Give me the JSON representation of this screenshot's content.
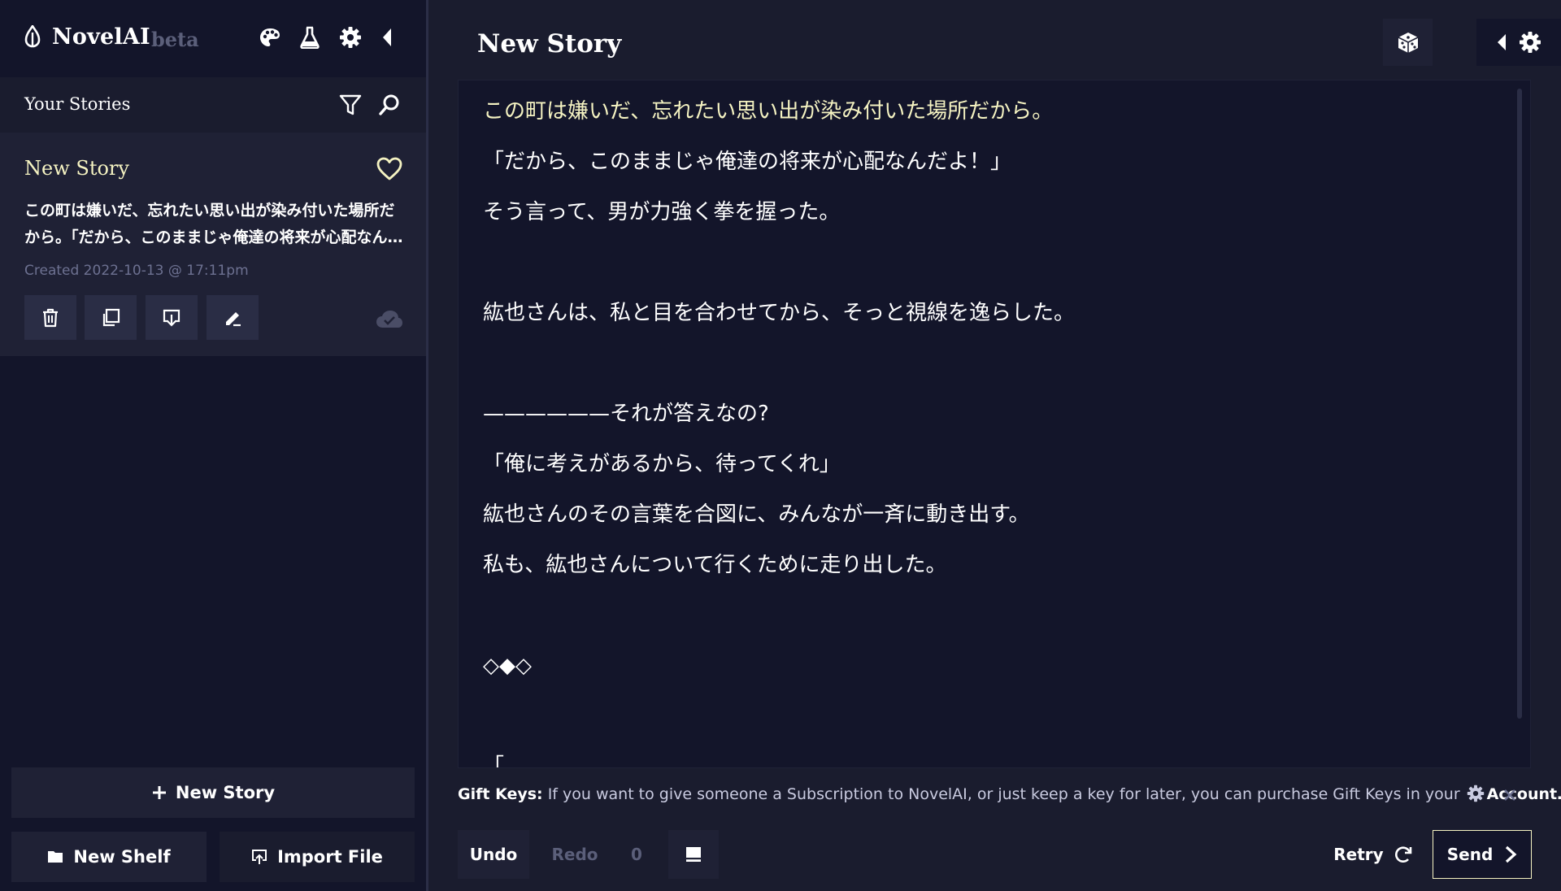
{
  "sidebar": {
    "brand": {
      "name": "NovelAI",
      "tag": "beta"
    },
    "header_icons": [
      "quill-logo-icon",
      "palette-icon",
      "flask-icon",
      "gear-icon",
      "collapse-left-icon"
    ],
    "stories_title": "Your Stories",
    "story_card": {
      "title": "New Story",
      "excerpt": "この町は嫌いだ、忘れたい思い出が染み付いた場所だから。「だから、このままじゃ俺達の将来が心配なんだよ！」",
      "created": "Created 2022-10-13 @ 17:11pm",
      "actions": [
        "trash-icon",
        "duplicate-icon",
        "download-icon",
        "edit-icon"
      ],
      "sync_icon": "cloud-icon"
    },
    "new_story_label": "New Story",
    "new_shelf_label": "New Shelf",
    "import_file_label": "Import File"
  },
  "main": {
    "title": "New Story",
    "editor_lines": [
      "この町は嫌いだ、忘れたい思い出が染み付いた場所だから。",
      "「だから、このままじゃ俺達の将来が心配なんだよ！」",
      "そう言って、男が力強く拳を握った。",
      "",
      "紘也さんは、私と目を合わせてから、そっと視線を逸らした。",
      "",
      "——————それが答えなの?",
      "「俺に考えがあるから、待ってくれ」",
      "紘也さんのその言葉を合図に、みんなが一斉に動き出す。",
      "私も、紘也さんについて行くために走り出した。",
      "",
      "◇◆◇",
      "",
      "「"
    ]
  },
  "gift_notice": {
    "label": "Gift Keys:",
    "text": "If you want to give someone a Subscription to NovelAI, or just keep a key for later, you can purchase Gift Keys in your",
    "link": "Account…"
  },
  "controls": {
    "undo_label": "Undo",
    "redo_label": "Redo",
    "undo_count": "0",
    "retry_label": "Retry",
    "send_label": "Send"
  },
  "colors": {
    "accent": "#f5f3c2",
    "background": "#1a1c2e",
    "panel": "#13152a",
    "muted": "#6d7191"
  }
}
